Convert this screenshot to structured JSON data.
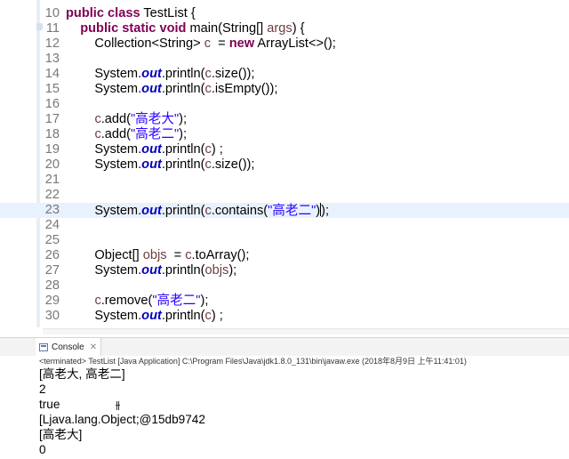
{
  "editor": {
    "lines": [
      {
        "num": "10",
        "tokens": [
          {
            "t": "kw",
            "v": "public"
          },
          {
            "t": "p",
            "v": " "
          },
          {
            "t": "kw",
            "v": "class"
          },
          {
            "t": "p",
            "v": " TestList {"
          }
        ]
      },
      {
        "num": "11",
        "tokens": [
          {
            "t": "p",
            "v": "    "
          },
          {
            "t": "kw",
            "v": "public"
          },
          {
            "t": "p",
            "v": " "
          },
          {
            "t": "kw",
            "v": "static"
          },
          {
            "t": "p",
            "v": " "
          },
          {
            "t": "kw",
            "v": "void"
          },
          {
            "t": "p",
            "v": " main(String[] "
          },
          {
            "t": "vr",
            "v": "args"
          },
          {
            "t": "p",
            "v": ") {"
          }
        ]
      },
      {
        "num": "12",
        "tokens": [
          {
            "t": "p",
            "v": "        Collection<String> "
          },
          {
            "t": "vr",
            "v": "c"
          },
          {
            "t": "p",
            "v": "  = "
          },
          {
            "t": "kw",
            "v": "new"
          },
          {
            "t": "p",
            "v": " ArrayList<>();"
          }
        ]
      },
      {
        "num": "13",
        "tokens": []
      },
      {
        "num": "14",
        "tokens": [
          {
            "t": "p",
            "v": "        System."
          },
          {
            "t": "fld",
            "v": "out"
          },
          {
            "t": "p",
            "v": ".println("
          },
          {
            "t": "vr",
            "v": "c"
          },
          {
            "t": "p",
            "v": ".size());"
          }
        ]
      },
      {
        "num": "15",
        "tokens": [
          {
            "t": "p",
            "v": "        System."
          },
          {
            "t": "fld",
            "v": "out"
          },
          {
            "t": "p",
            "v": ".println("
          },
          {
            "t": "vr",
            "v": "c"
          },
          {
            "t": "p",
            "v": ".isEmpty());"
          }
        ]
      },
      {
        "num": "16",
        "tokens": []
      },
      {
        "num": "17",
        "tokens": [
          {
            "t": "p",
            "v": "        "
          },
          {
            "t": "vr",
            "v": "c"
          },
          {
            "t": "p",
            "v": ".add("
          },
          {
            "t": "str",
            "v": "\"高老大\""
          },
          {
            "t": "p",
            "v": ");"
          }
        ]
      },
      {
        "num": "18",
        "tokens": [
          {
            "t": "p",
            "v": "        "
          },
          {
            "t": "vr",
            "v": "c"
          },
          {
            "t": "p",
            "v": ".add("
          },
          {
            "t": "str",
            "v": "\"高老二\""
          },
          {
            "t": "p",
            "v": ");"
          }
        ]
      },
      {
        "num": "19",
        "tokens": [
          {
            "t": "p",
            "v": "        System."
          },
          {
            "t": "fld",
            "v": "out"
          },
          {
            "t": "p",
            "v": ".println("
          },
          {
            "t": "vr",
            "v": "c"
          },
          {
            "t": "p",
            "v": ") ;"
          }
        ]
      },
      {
        "num": "20",
        "tokens": [
          {
            "t": "p",
            "v": "        System."
          },
          {
            "t": "fld",
            "v": "out"
          },
          {
            "t": "p",
            "v": ".println("
          },
          {
            "t": "vr",
            "v": "c"
          },
          {
            "t": "p",
            "v": ".size());"
          }
        ]
      },
      {
        "num": "21",
        "tokens": []
      },
      {
        "num": "22",
        "tokens": []
      },
      {
        "num": "23",
        "highlight": true,
        "tokens": [
          {
            "t": "p",
            "v": "        System."
          },
          {
            "t": "fld",
            "v": "out"
          },
          {
            "t": "p",
            "v": ".println("
          },
          {
            "t": "vr",
            "v": "c"
          },
          {
            "t": "p",
            "v": ".contains("
          },
          {
            "t": "str",
            "v": "\"高老二\""
          },
          {
            "t": "p",
            "v": ")"
          },
          {
            "t": "cur",
            "v": ""
          },
          {
            "t": "p",
            "v": ");"
          }
        ]
      },
      {
        "num": "24",
        "tokens": []
      },
      {
        "num": "25",
        "tokens": []
      },
      {
        "num": "26",
        "tokens": [
          {
            "t": "p",
            "v": "        Object[] "
          },
          {
            "t": "vr",
            "v": "objs"
          },
          {
            "t": "p",
            "v": "  = "
          },
          {
            "t": "vr",
            "v": "c"
          },
          {
            "t": "p",
            "v": ".toArray();"
          }
        ]
      },
      {
        "num": "27",
        "tokens": [
          {
            "t": "p",
            "v": "        System."
          },
          {
            "t": "fld",
            "v": "out"
          },
          {
            "t": "p",
            "v": ".println("
          },
          {
            "t": "vr",
            "v": "objs"
          },
          {
            "t": "p",
            "v": ");"
          }
        ]
      },
      {
        "num": "28",
        "tokens": []
      },
      {
        "num": "29",
        "tokens": [
          {
            "t": "p",
            "v": "        "
          },
          {
            "t": "vr",
            "v": "c"
          },
          {
            "t": "p",
            "v": ".remove("
          },
          {
            "t": "str",
            "v": "\"高老二\""
          },
          {
            "t": "p",
            "v": ");"
          }
        ]
      },
      {
        "num": "30",
        "tokens": [
          {
            "t": "p",
            "v": "        System."
          },
          {
            "t": "fld",
            "v": "out"
          },
          {
            "t": "p",
            "v": ".println("
          },
          {
            "t": "vr",
            "v": "c"
          },
          {
            "t": "p",
            "v": ") ;"
          }
        ]
      }
    ]
  },
  "console": {
    "tab_label": "Console",
    "tab_icon": "console-icon",
    "close_icon": "close-icon",
    "status": "<terminated> TestList [Java Application] C:\\Program Files\\Java\\jdk1.8.0_131\\bin\\javaw.exe (2018年8月9日 上午11:41:01)",
    "output": [
      "[高老大, 高老二]",
      "2",
      "true",
      "[Ljava.lang.Object;@15db9742",
      "[高老大]",
      "0"
    ]
  }
}
